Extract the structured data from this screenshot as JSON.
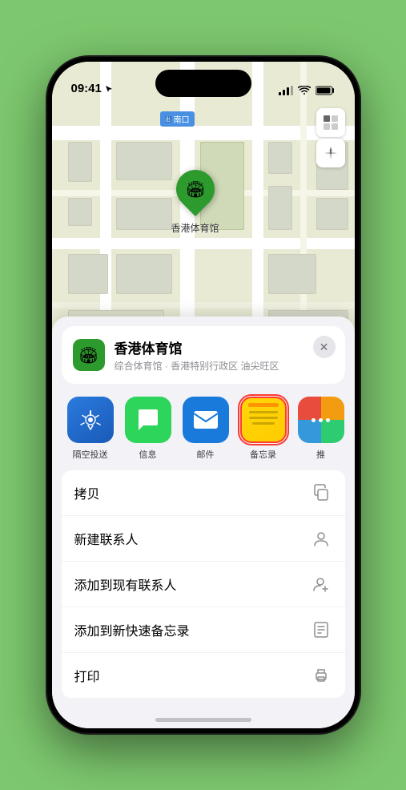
{
  "status_bar": {
    "time": "09:41",
    "location_arrow": true
  },
  "map": {
    "label_text": "南口",
    "location_name": "香港体育馆",
    "pin_emoji": "🏟"
  },
  "location_card": {
    "name": "香港体育馆",
    "subtitle": "综合体育馆 · 香港特别行政区 油尖旺区",
    "close_label": "×"
  },
  "share_items": [
    {
      "id": "airdrop",
      "label": "隔空投送",
      "type": "airdrop"
    },
    {
      "id": "messages",
      "label": "信息",
      "type": "messages"
    },
    {
      "id": "mail",
      "label": "邮件",
      "type": "mail"
    },
    {
      "id": "notes",
      "label": "备忘录",
      "type": "notes"
    },
    {
      "id": "more",
      "label": "推",
      "type": "more"
    }
  ],
  "menu_items": [
    {
      "id": "copy",
      "label": "拷贝",
      "icon": "copy"
    },
    {
      "id": "new-contact",
      "label": "新建联系人",
      "icon": "person"
    },
    {
      "id": "add-existing",
      "label": "添加到现有联系人",
      "icon": "person-add"
    },
    {
      "id": "add-notes",
      "label": "添加到新快速备忘录",
      "icon": "note"
    },
    {
      "id": "print",
      "label": "打印",
      "icon": "print"
    }
  ]
}
